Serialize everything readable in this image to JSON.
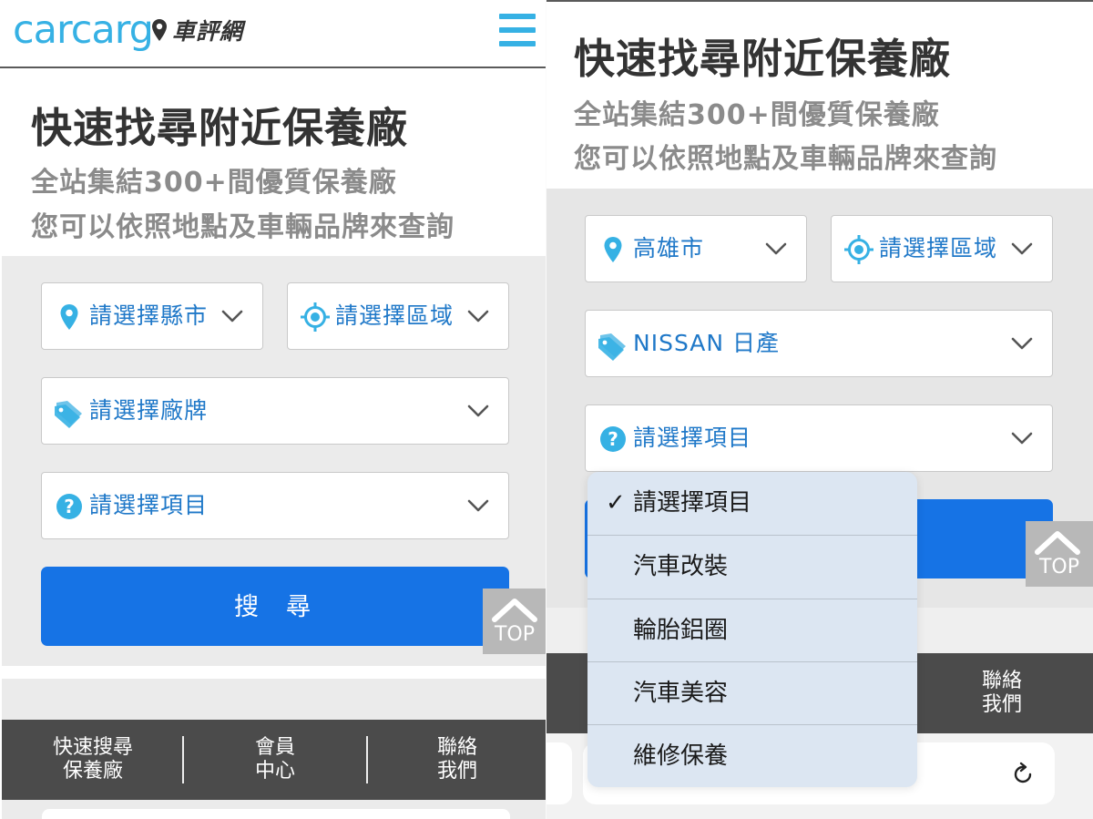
{
  "left": {
    "header": {
      "logo_text": "carcarg",
      "logo_cjk": "車評網"
    },
    "title": "快速找尋附近保養廠",
    "subtitle_line1": "全站集結300+間優質保養廠",
    "subtitle_line2": "您可以依照地點及車輛品牌來查詢",
    "city_select": "請選擇縣市",
    "district_select": "請選擇區域",
    "brand_select": "請選擇廠牌",
    "service_select": "請選擇項目",
    "search_button": "搜尋",
    "top_button": "TOP",
    "bottom_nav": [
      {
        "line1": "快速搜尋",
        "line2": "保養廠"
      },
      {
        "line1": "會員",
        "line2": "中心"
      },
      {
        "line1": "聯絡",
        "line2": "我們"
      }
    ]
  },
  "right": {
    "title": "快速找尋附近保養廠",
    "subtitle_line1": "全站集結300+間優質保養廠",
    "subtitle_line2": "您可以依照地點及車輛品牌來查詢",
    "city_select": "高雄市",
    "district_select": "請選擇區域",
    "brand_select": "NISSAN 日產",
    "service_select": "請選擇項目",
    "top_button": "TOP",
    "contact_nav": {
      "line1": "聯絡",
      "line2": "我們"
    },
    "dropdown": {
      "options": [
        "請選擇項目",
        "汽車改裝",
        "輪胎鋁圈",
        "汽車美容",
        "維修保養"
      ],
      "checkmark": "✓"
    }
  },
  "colors": {
    "accent": "#1673e5",
    "logo_blue": "#36b1e4",
    "label_blue": "#1f78c8",
    "bottom_bar": "#4b4b4b",
    "dropdown_bg": "#dce6f2"
  },
  "icons": [
    "location-pin-icon",
    "crosshair-target-icon",
    "tag-icon",
    "question-icon",
    "chevron-down-icon",
    "chevron-up-icon",
    "reload-icon",
    "hamburger-menu-icon",
    "checkmark-icon"
  ]
}
